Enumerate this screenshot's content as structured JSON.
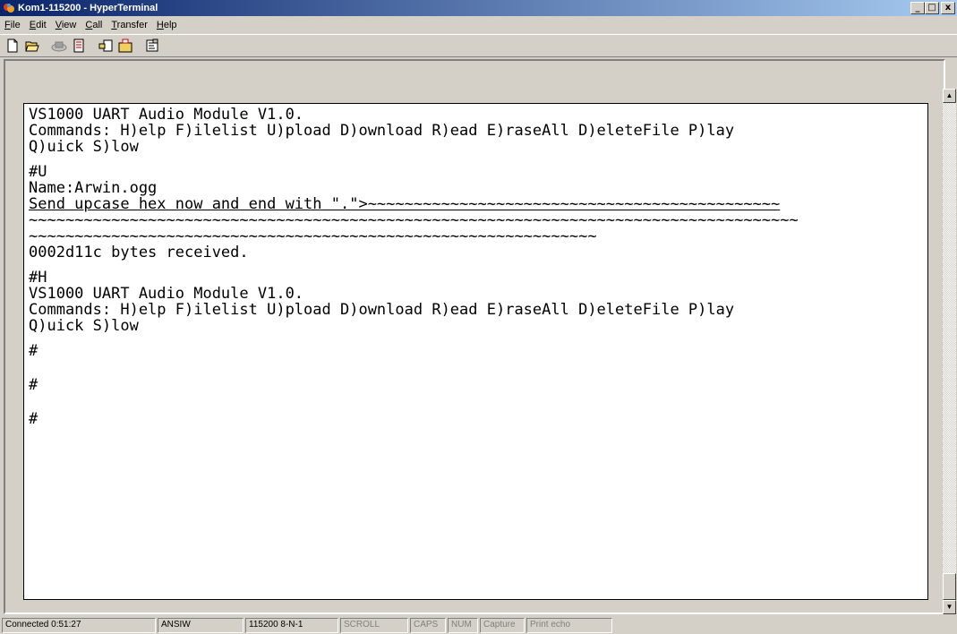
{
  "window": {
    "title": "Kom1-115200 - HyperTerminal",
    "min_label": "_",
    "max_label": "□",
    "close_label": "x"
  },
  "menu": [
    {
      "label": "File"
    },
    {
      "label": "Edit"
    },
    {
      "label": "View"
    },
    {
      "label": "Call"
    },
    {
      "label": "Transfer"
    },
    {
      "label": "Help"
    }
  ],
  "toolbar": {
    "buttons": [
      "new-icon",
      "open-icon",
      "disconnect-icon",
      "call-icon",
      "send-icon",
      "receive-icon",
      "properties-icon"
    ]
  },
  "terminal": {
    "lines": [
      "VS1000 UART Audio Module V1.0.",
      "Commands: H)elp F)ilelist U)pload D)ownload R)ead E)raseAll D)eleteFile P)lay",
      "Q)uick S)low",
      "",
      "#U",
      "Name:Arwin.ogg",
      "Send upcase hex now and end with \".\">~~~~~~~~~~~~~~~~~~~~~~~~~~~~~~~~~~~~~~~~~~~~~",
      "~~~~~~~~~~~~~~~~~~~~~~~~~~~~~~~~~~~~~~~~~~~~~~~~~~~~~~~~~~~~~~~~~~~~~~~~~~~~~~~~~~~~",
      "~~~~~~~~~~~~~~~~~~~~~~~~~~~~~~~~~~~~~~~~~~~~~~~~~~~~~~~~~~~~~~",
      "0002d11c bytes received.",
      "",
      "#H",
      "VS1000 UART Audio Module V1.0.",
      "Commands: H)elp F)ilelist U)pload D)ownload R)ead E)raseAll D)eleteFile P)lay",
      "Q)uick S)low",
      "",
      "#",
      "",
      "",
      "#",
      "",
      "",
      "#"
    ]
  },
  "status": {
    "connected": "Connected 0:51:27",
    "emulation": "ANSIW",
    "port_settings": "115200 8-N-1",
    "scroll": "SCROLL",
    "caps": "CAPS",
    "num": "NUM",
    "capture": "Capture",
    "print_echo": "Print echo"
  },
  "colors": {
    "titlebar_start": "#0a246a",
    "titlebar_end": "#a6caf0",
    "chrome": "#d4d0c8"
  }
}
